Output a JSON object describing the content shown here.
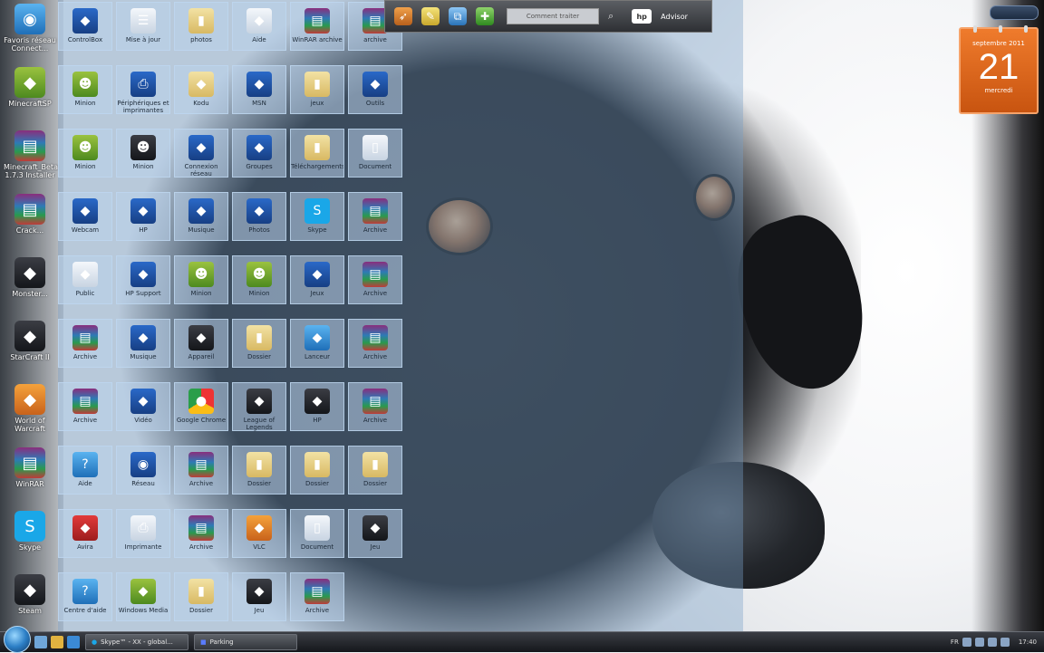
{
  "left_icons": [
    {
      "label": "Favoris réseau Connect...",
      "icon": "network-globe-icon",
      "style": "g-blue2"
    },
    {
      "label": "MinecraftSP",
      "icon": "minecraft-icon",
      "style": "g-green"
    },
    {
      "label": "Minecraft_Beta 1.7.3 Installer",
      "icon": "winrar-icon",
      "style": "g-rar"
    },
    {
      "label": "Crack...",
      "icon": "winrar-icon",
      "style": "g-rar"
    },
    {
      "label": "Monster...",
      "icon": "game-helmet-icon",
      "style": "g-dark"
    },
    {
      "label": "StarCraft II",
      "icon": "starcraft-icon",
      "style": "g-dark"
    },
    {
      "label": "World of Warcraft",
      "icon": "warcraft-icon",
      "style": "g-orange"
    },
    {
      "label": "WinRAR",
      "icon": "winrar-icon",
      "style": "g-rar"
    },
    {
      "label": "Skype",
      "icon": "skype-icon",
      "style": "g-skype"
    },
    {
      "label": "Steam",
      "icon": "steam-icon",
      "style": "g-dark"
    }
  ],
  "grid": [
    [
      {
        "label": "ControlBox",
        "icon": "control-panel-icon",
        "style": "g-app"
      },
      {
        "label": "Mise à jour",
        "icon": "document-list-icon",
        "style": "g-doc"
      },
      {
        "label": "photos",
        "icon": "folder-icon",
        "style": "g-folder"
      },
      {
        "label": "Aide",
        "icon": "notepad-icon",
        "style": "g-doc"
      },
      {
        "label": "WinRAR archive",
        "icon": "winrar-icon",
        "style": "g-rar"
      },
      {
        "label": "archive",
        "icon": "winrar-icon",
        "style": "g-rar"
      }
    ],
    [
      {
        "label": "Minion",
        "icon": "minion-icon",
        "style": "g-green"
      },
      {
        "label": "Périphériques et imprimantes",
        "icon": "printer-icon",
        "style": "g-app"
      },
      {
        "label": "Kodu",
        "icon": "book-icon",
        "style": "g-folder"
      },
      {
        "label": "MSN",
        "icon": "msn-butterfly-icon",
        "style": "g-app"
      },
      {
        "label": "jeux",
        "icon": "folder-icon",
        "style": "g-folder"
      },
      {
        "label": "Outils",
        "icon": "compass-icon",
        "style": "g-app"
      }
    ],
    [
      {
        "label": "Minion",
        "icon": "minion-icon",
        "style": "g-green"
      },
      {
        "label": "Minion",
        "icon": "minion-icon",
        "style": "g-dark"
      },
      {
        "label": "Connexion réseau",
        "icon": "network-icon",
        "style": "g-app"
      },
      {
        "label": "Groupes",
        "icon": "users-icon",
        "style": "g-app"
      },
      {
        "label": "Téléchargements",
        "icon": "folder-icon",
        "style": "g-folder"
      },
      {
        "label": "Document",
        "icon": "document-icon",
        "style": "g-doc"
      }
    ],
    [
      {
        "label": "Webcam",
        "icon": "webcam-icon",
        "style": "g-app"
      },
      {
        "label": "HP",
        "icon": "hp-icon",
        "style": "g-app"
      },
      {
        "label": "Musique",
        "icon": "media-player-icon",
        "style": "g-app"
      },
      {
        "label": "Photos",
        "icon": "dvd-icon",
        "style": "g-app"
      },
      {
        "label": "Skype",
        "icon": "skype-icon",
        "style": "g-skype"
      },
      {
        "label": "Archive",
        "icon": "winrar-icon",
        "style": "g-rar"
      }
    ],
    [
      {
        "label": "Public",
        "icon": "tablet-icon",
        "style": "g-doc"
      },
      {
        "label": "HP Support",
        "icon": "hp-support-icon",
        "style": "g-app"
      },
      {
        "label": "Minion",
        "icon": "minion-icon",
        "style": "g-green"
      },
      {
        "label": "Minion",
        "icon": "minion-icon",
        "style": "g-green"
      },
      {
        "label": "Jeux",
        "icon": "gamepad-icon",
        "style": "g-app"
      },
      {
        "label": "Archive",
        "icon": "winrar-icon",
        "style": "g-rar"
      }
    ],
    [
      {
        "label": "Archive",
        "icon": "winrar-icon",
        "style": "g-rar"
      },
      {
        "label": "Musique",
        "icon": "music-icon",
        "style": "g-app"
      },
      {
        "label": "Appareil",
        "icon": "camera-icon",
        "style": "g-dark"
      },
      {
        "label": "Dossier",
        "icon": "folder-icon",
        "style": "g-folder"
      },
      {
        "label": "Lanceur",
        "icon": "lightning-icon",
        "style": "g-blue2"
      },
      {
        "label": "Archive",
        "icon": "winrar-icon",
        "style": "g-rar"
      }
    ],
    [
      {
        "label": "Archive",
        "icon": "winrar-icon",
        "style": "g-rar"
      },
      {
        "label": "Vidéo",
        "icon": "video-icon",
        "style": "g-app"
      },
      {
        "label": "Google Chrome",
        "icon": "chrome-icon",
        "style": "g-chrome"
      },
      {
        "label": "League of Legends",
        "icon": "league-icon",
        "style": "g-dark"
      },
      {
        "label": "HP",
        "icon": "hp-logo-icon",
        "style": "g-dark"
      },
      {
        "label": "Archive",
        "icon": "winrar-icon",
        "style": "g-rar"
      }
    ],
    [
      {
        "label": "Aide",
        "icon": "help-icon",
        "style": "g-blue2"
      },
      {
        "label": "Réseau",
        "icon": "network-globe-icon",
        "style": "g-app"
      },
      {
        "label": "Archive",
        "icon": "winrar-icon",
        "style": "g-rar"
      },
      {
        "label": "Dossier",
        "icon": "folder-icon",
        "style": "g-folder"
      },
      {
        "label": "Dossier",
        "icon": "folder-icon",
        "style": "g-folder"
      },
      {
        "label": "Dossier",
        "icon": "folder-icon",
        "style": "g-folder"
      }
    ],
    [
      {
        "label": "Avira",
        "icon": "avira-icon",
        "style": "g-red"
      },
      {
        "label": "Imprimante",
        "icon": "printer-icon",
        "style": "g-doc"
      },
      {
        "label": "Archive",
        "icon": "winrar-icon",
        "style": "g-rar"
      },
      {
        "label": "VLC",
        "icon": "vlc-icon",
        "style": "g-orange"
      },
      {
        "label": "Document",
        "icon": "document-icon",
        "style": "g-doc"
      },
      {
        "label": "Jeu",
        "icon": "game-icon",
        "style": "g-dark"
      }
    ],
    [
      {
        "label": "Centre d'aide",
        "icon": "help-center-icon",
        "style": "g-blue2"
      },
      {
        "label": "Windows Media",
        "icon": "windows-media-icon",
        "style": "g-green"
      },
      {
        "label": "Dossier",
        "icon": "folder-icon",
        "style": "g-folder"
      },
      {
        "label": "Jeu",
        "icon": "silhouette-icon",
        "style": "g-dark"
      },
      {
        "label": "Archive",
        "icon": "winrar-icon",
        "style": "g-rar"
      }
    ]
  ],
  "toolbar": {
    "search_placeholder": "Comment traiter",
    "hp_label": "hp",
    "advisor_label": "Advisor"
  },
  "calendar": {
    "month_year": "septembre 2011",
    "day": "21",
    "weekday": "mercredi"
  },
  "taskbar": {
    "items": [
      {
        "label": "Skype™ - XX - global..."
      },
      {
        "label": "Parking"
      }
    ],
    "tray_lang": "FR",
    "clock": "17:40"
  }
}
